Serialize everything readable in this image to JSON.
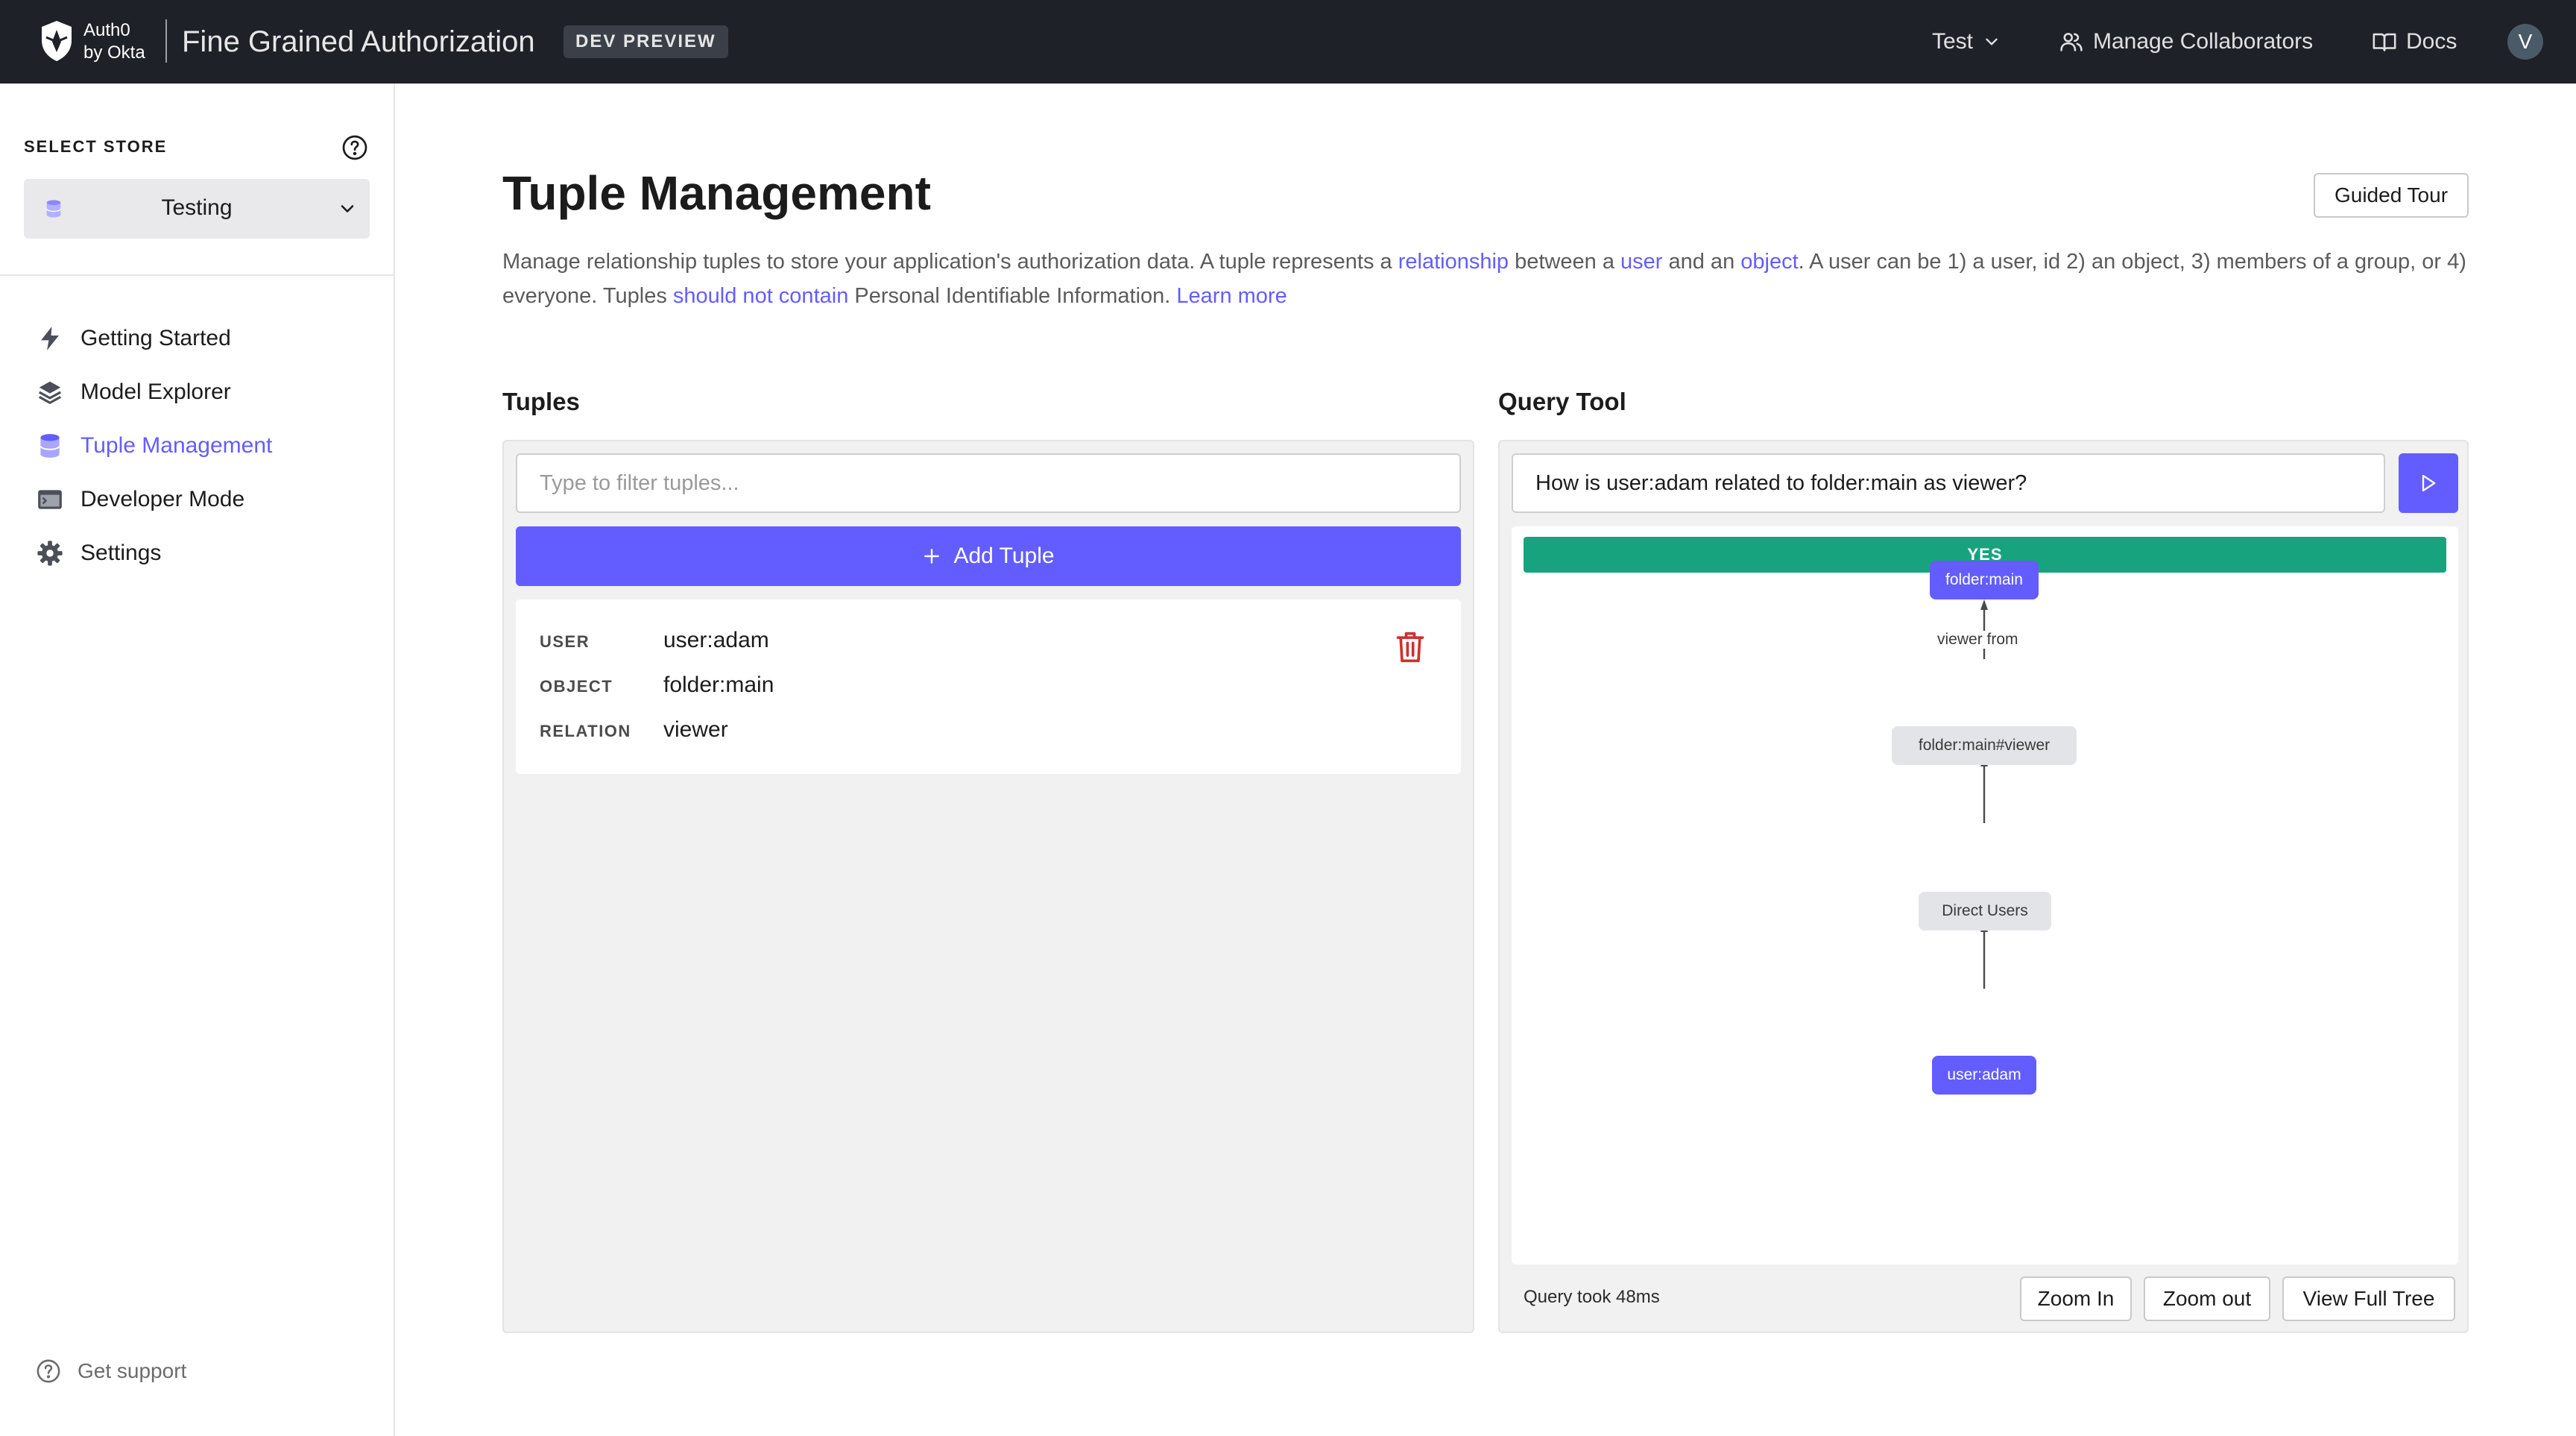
{
  "brand": {
    "logo_line1": "Auth0",
    "logo_line2": "by Okta",
    "app_title": "Fine Grained Authorization",
    "badge": "DEV PREVIEW"
  },
  "topnav": {
    "tenant": "Test",
    "collaborators": "Manage Collaborators",
    "docs": "Docs",
    "avatar_initial": "V"
  },
  "sidebar": {
    "select_store_label": "SELECT STORE",
    "store_value": "Testing",
    "items": [
      {
        "label": "Getting Started",
        "icon": "bolt-icon"
      },
      {
        "label": "Model Explorer",
        "icon": "layers-icon"
      },
      {
        "label": "Tuple Management",
        "icon": "database-icon",
        "active": true
      },
      {
        "label": "Developer Mode",
        "icon": "terminal-icon"
      },
      {
        "label": "Settings",
        "icon": "gear-icon"
      }
    ],
    "support": "Get support"
  },
  "main": {
    "title": "Tuple Management",
    "guided_tour": "Guided Tour",
    "description": {
      "p1": "Manage relationship tuples to store your application's authorization data. A tuple represents a ",
      "l1": "relationship",
      "p2": " between a ",
      "l2": "user",
      "p3": " and an ",
      "l3": "object",
      "p4": ". A user can be 1) a user, id 2) an object, 3) members of a group, or 4) everyone. Tuples ",
      "l4": "should not contain",
      "p5": " Personal Identifiable Information. ",
      "l5": "Learn more"
    }
  },
  "tuples": {
    "title": "Tuples",
    "filter_placeholder": "Type to filter tuples...",
    "add_label": "Add Tuple",
    "list": [
      {
        "user_key": "USER",
        "user": "user:adam",
        "object_key": "OBJECT",
        "object": "folder:main",
        "relation_key": "RELATION",
        "relation": "viewer"
      }
    ]
  },
  "query": {
    "title": "Query Tool",
    "input_value": "How is user:adam related to folder:main as viewer?",
    "result": "YES",
    "graph": {
      "nodes": [
        "folder:main",
        "folder:main#viewer",
        "Direct Users",
        "user:adam"
      ],
      "edge_label": "viewer from"
    },
    "time": "Query took 48ms",
    "zoom_in": "Zoom In",
    "zoom_out": "Zoom out",
    "full_tree": "View Full Tree"
  },
  "colors": {
    "accent": "#635dff",
    "success": "#18a37f",
    "topbar": "#1e2127",
    "danger": "#d0312d"
  }
}
